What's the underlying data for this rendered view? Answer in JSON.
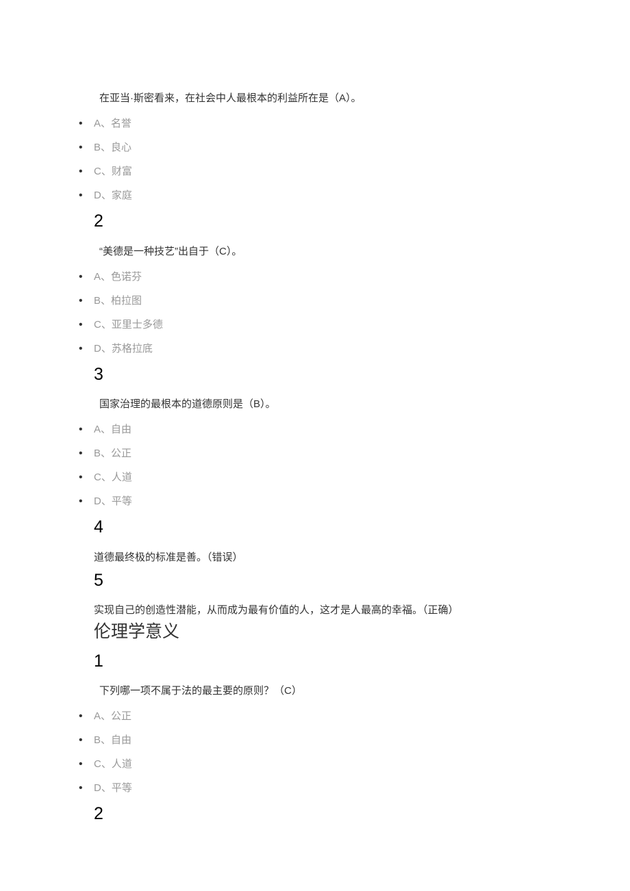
{
  "sections": [
    {
      "items": [
        {
          "type": "mc",
          "question": "在亚当·斯密看来，在社会中人最根本的利益所在是（A）。",
          "options": [
            {
              "letter": "A、",
              "text": "名誉"
            },
            {
              "letter": "B、",
              "text": "良心"
            },
            {
              "letter": "C、",
              "text": "财富"
            },
            {
              "letter": "D、",
              "text": "家庭"
            }
          ]
        },
        {
          "type": "num",
          "value": "2"
        },
        {
          "type": "mc",
          "question": "“美德是一种技艺”出自于（C）。",
          "options": [
            {
              "letter": "A、",
              "text": "色诺芬"
            },
            {
              "letter": "B、",
              "text": "柏拉图"
            },
            {
              "letter": "C、",
              "text": "亚里士多德"
            },
            {
              "letter": "D、",
              "text": "苏格拉底"
            }
          ]
        },
        {
          "type": "num",
          "value": "3"
        },
        {
          "type": "mc",
          "question": "国家治理的最根本的道德原则是（B）。",
          "options": [
            {
              "letter": "A、",
              "text": "自由"
            },
            {
              "letter": "B、",
              "text": "公正"
            },
            {
              "letter": "C、",
              "text": "人道"
            },
            {
              "letter": "D、",
              "text": "平等"
            }
          ]
        },
        {
          "type": "num",
          "value": "4"
        },
        {
          "type": "statement",
          "text": "道德最终极的标准是善。（错误）"
        },
        {
          "type": "num",
          "value": "5"
        },
        {
          "type": "statement",
          "text": "实现自己的创造性潜能，从而成为最有价值的人，这才是人最高的幸福。（正确）"
        },
        {
          "type": "section",
          "text": "伦理学意义"
        },
        {
          "type": "num",
          "value": "1"
        },
        {
          "type": "mc",
          "question": "下列哪一项不属于法的最主要的原则？（C）",
          "options": [
            {
              "letter": "A、",
              "text": "公正"
            },
            {
              "letter": "B、",
              "text": "自由"
            },
            {
              "letter": "C、",
              "text": "人道"
            },
            {
              "letter": "D、",
              "text": "平等"
            }
          ]
        },
        {
          "type": "num",
          "value": "2"
        }
      ]
    }
  ]
}
